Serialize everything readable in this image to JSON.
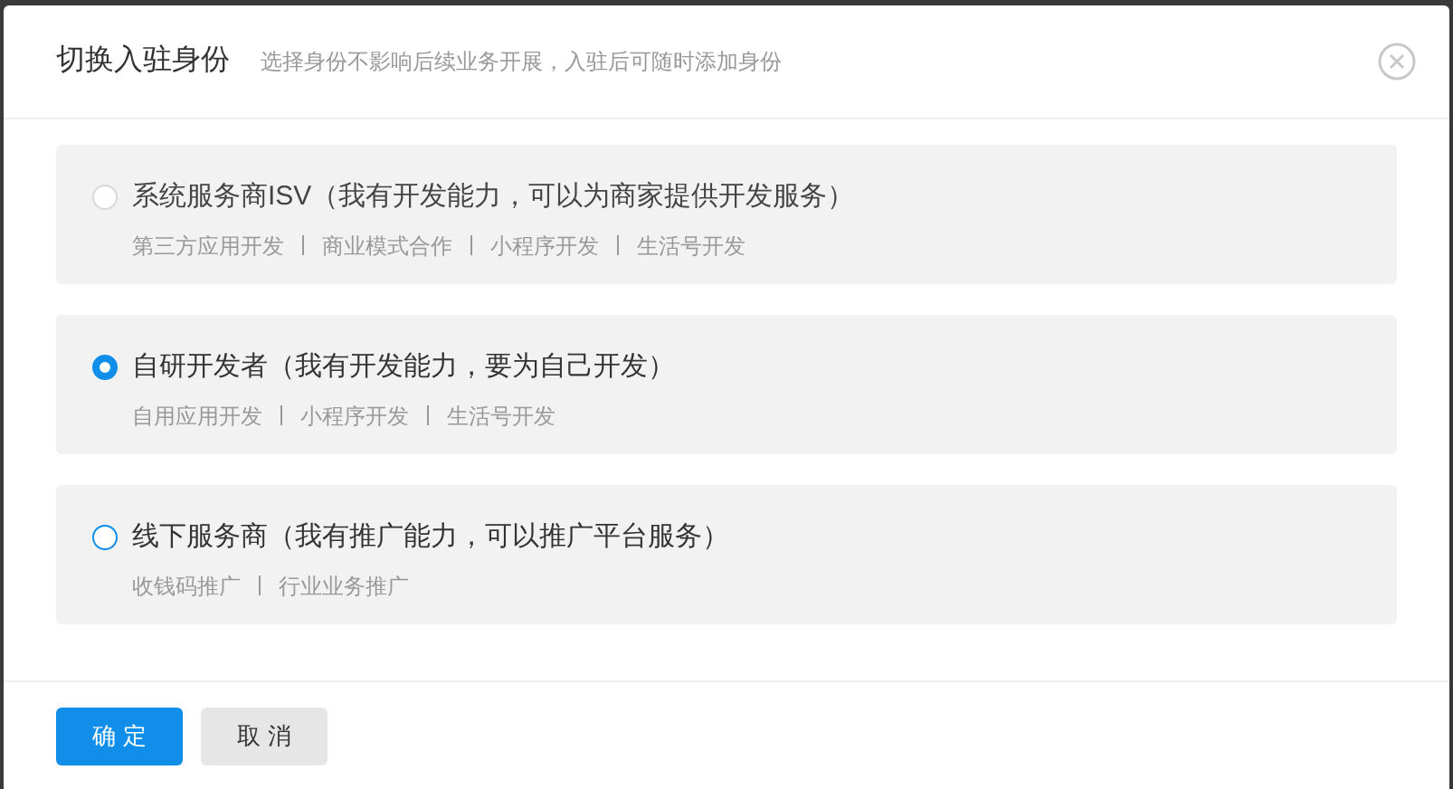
{
  "dialog": {
    "title": "切换入驻身份",
    "subtitle": "选择身份不影响后续业务开展，入驻后可随时添加身份"
  },
  "options": [
    {
      "label": "系统服务商ISV（我有开发能力，可以为商家提供开发服务）",
      "selected": false,
      "disabled": true,
      "tags": [
        "第三方应用开发",
        "商业模式合作",
        "小程序开发",
        "生活号开发"
      ]
    },
    {
      "label": "自研开发者（我有开发能力，要为自己开发）",
      "selected": true,
      "disabled": false,
      "tags": [
        "自用应用开发",
        "小程序开发",
        "生活号开发"
      ]
    },
    {
      "label": "线下服务商（我有推广能力，可以推广平台服务）",
      "selected": false,
      "disabled": false,
      "tags": [
        "收钱码推广",
        "行业业务推广"
      ]
    }
  ],
  "buttons": [
    {
      "label": "确 定",
      "kind": "primary"
    },
    {
      "label": "取 消",
      "kind": "secondary"
    }
  ]
}
